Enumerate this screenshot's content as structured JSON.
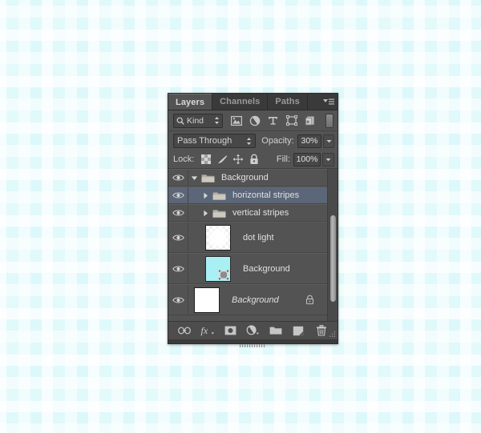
{
  "document": {
    "background_pattern": "cyan-plaid",
    "background_color": "#ddf8fb"
  },
  "panel": {
    "title": "Layers",
    "tabs": [
      {
        "label": "Layers",
        "active": true
      },
      {
        "label": "Channels",
        "active": false
      },
      {
        "label": "Paths",
        "active": false
      }
    ],
    "menu_icon": "panel-menu-icon"
  },
  "filter_bar": {
    "kind_label": "Kind",
    "search_icon": "search-icon",
    "stepper_icon": "up-down-arrows-icon",
    "filters": [
      {
        "name": "filter-pixel-layers",
        "icon": "image-icon"
      },
      {
        "name": "filter-adjustment-layers",
        "icon": "adjustment-circle-icon"
      },
      {
        "name": "filter-type-layers",
        "icon": "type-t-icon"
      },
      {
        "name": "filter-shape-layers",
        "icon": "shape-bounding-box-icon"
      },
      {
        "name": "filter-smart-objects",
        "icon": "smart-object-icon"
      }
    ],
    "toggle_name": "filter-enable-toggle"
  },
  "blend_bar": {
    "blend_mode": "Pass Through",
    "opacity_label": "Opacity:",
    "opacity_value": "30%"
  },
  "lock_bar": {
    "lock_label": "Lock:",
    "fill_label": "Fill:",
    "fill_value": "100%",
    "lock_buttons": [
      {
        "name": "lock-transparent-pixels",
        "icon": "checkerboard-icon"
      },
      {
        "name": "lock-image-pixels",
        "icon": "brush-icon"
      },
      {
        "name": "lock-position",
        "icon": "move-arrows-icon"
      },
      {
        "name": "lock-all",
        "icon": "lock-icon"
      }
    ]
  },
  "layers": [
    {
      "name": "Background",
      "type": "group",
      "visible": true,
      "selected": false,
      "expanded": true,
      "indent": 0,
      "disclosure": "triangle-down-icon",
      "thumb": "folder",
      "locked": false,
      "italic": false
    },
    {
      "name": "horizontal stripes",
      "type": "group",
      "visible": true,
      "selected": true,
      "expanded": false,
      "indent": 1,
      "disclosure": "triangle-right-icon",
      "thumb": "folder",
      "locked": false,
      "italic": false
    },
    {
      "name": "vertical stripes",
      "type": "group",
      "visible": true,
      "selected": false,
      "expanded": false,
      "indent": 1,
      "disclosure": "triangle-right-icon",
      "thumb": "folder",
      "locked": false,
      "italic": false
    },
    {
      "name": "dot light",
      "type": "layer",
      "visible": true,
      "selected": false,
      "indent": 1,
      "thumb": "checker",
      "locked": false,
      "italic": false
    },
    {
      "name": "Background",
      "type": "layer",
      "visible": true,
      "selected": false,
      "indent": 1,
      "thumb": "cyan",
      "thumb_color": "#a9f0f5",
      "badge": "transform-badge-icon",
      "locked": false,
      "italic": false
    },
    {
      "name": "Background",
      "type": "layer",
      "visible": true,
      "selected": false,
      "indent": 0,
      "thumb": "white",
      "locked": true,
      "lock_icon": "lock-icon",
      "italic": true
    }
  ],
  "footer_buttons": [
    {
      "name": "link-layers-button",
      "icon": "link-icon"
    },
    {
      "name": "layer-style-button",
      "icon": "fx-icon"
    },
    {
      "name": "add-layer-mask-button",
      "icon": "mask-icon"
    },
    {
      "name": "new-fill-adjustment-button",
      "icon": "half-circle-icon"
    },
    {
      "name": "new-group-button",
      "icon": "folder-icon"
    },
    {
      "name": "new-layer-button",
      "icon": "new-layer-icon"
    },
    {
      "name": "delete-layer-button",
      "icon": "trash-icon"
    }
  ],
  "colors": {
    "panel_bg": "#535353",
    "tab_bg": "#3a3a3a",
    "selection": "#5b6678",
    "text": "#d8d8d8",
    "thumb_cyan": "#a9f0f5"
  }
}
